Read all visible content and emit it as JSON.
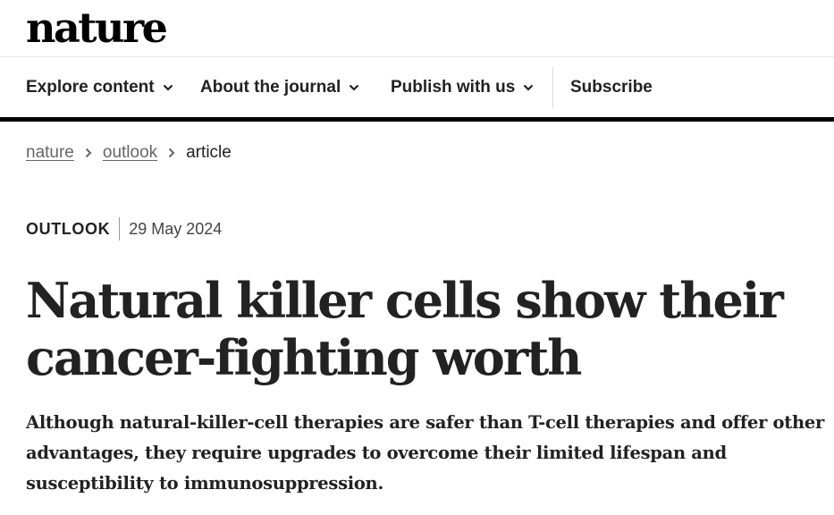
{
  "site": {
    "logo": "nature"
  },
  "nav": {
    "items": [
      {
        "label": "Explore content"
      },
      {
        "label": "About the journal"
      },
      {
        "label": "Publish with us"
      }
    ],
    "subscribe": "Subscribe"
  },
  "breadcrumb": {
    "items": [
      {
        "label": "nature"
      },
      {
        "label": "outlook"
      }
    ],
    "current": "article"
  },
  "article": {
    "type": "OUTLOOK",
    "date": "29 May 2024",
    "title": "Natural killer cells show their cancer-fighting worth",
    "standfirst": "Although natural-killer-cell therapies are safer than T-cell therapies and offer other advantages, they require upgrades to overcome their limited lifespan and susceptibility to immunosuppression."
  },
  "icons": {
    "nav_chevron": "chevron-down-icon",
    "breadcrumb_separator": "chevron-right-icon"
  }
}
